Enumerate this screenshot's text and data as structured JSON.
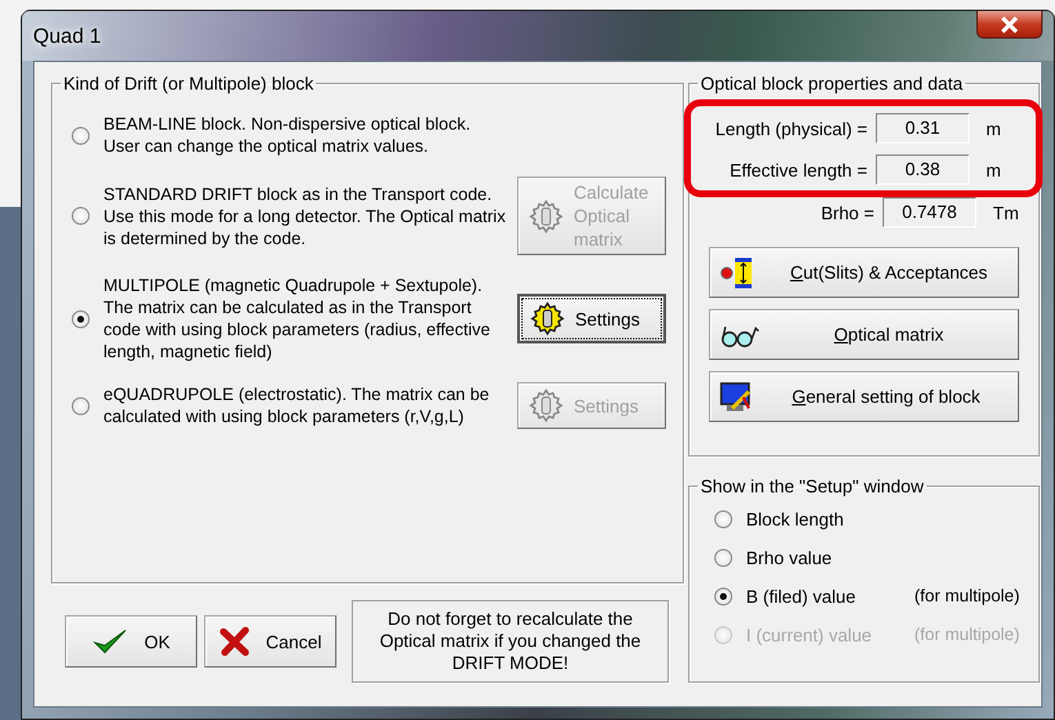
{
  "window": {
    "title": "Quad 1"
  },
  "drift_group": {
    "title": "Kind of Drift (or Multipole) block",
    "options": [
      {
        "text": "BEAM-LINE block. Non-dispersive optical block. User can change the optical matrix values.",
        "selected": false
      },
      {
        "text": " STANDARD DRIFT block as in the Transport code. Use this mode for a long detector. The Optical matrix is determined by the code.",
        "selected": false,
        "button": {
          "label": "Calculate Optical matrix",
          "disabled": true,
          "focused": false
        }
      },
      {
        "text": "MULTIPOLE (magnetic Quadrupole + Sextupole). The matrix can be calculated as in the Transport code with using block parameters  (radius, effective length, magnetic field)",
        "selected": true,
        "button": {
          "label": "Settings",
          "disabled": false,
          "focused": true
        }
      },
      {
        "text": "eQUADRUPOLE (electrostatic). The matrix can be calculated with using block parameters  (r,V,g,L)",
        "selected": false,
        "button": {
          "label": "Settings",
          "disabled": true,
          "focused": false
        }
      }
    ]
  },
  "properties": {
    "title": "Optical block properties and data",
    "fields": [
      {
        "label": "Length (physical) =",
        "value": "0.31",
        "unit": "m",
        "highlighted": true
      },
      {
        "label": "Effective length =",
        "value": "0.38",
        "unit": "m",
        "highlighted": true
      },
      {
        "label": "Brho =",
        "value": "0.7478",
        "unit": "Tm",
        "highlighted": false
      }
    ],
    "actions": [
      {
        "kind": "slits",
        "key": "C",
        "rest": "ut(Slits) & Acceptances"
      },
      {
        "kind": "matrix",
        "key": "O",
        "rest": "ptical matrix"
      },
      {
        "kind": "general",
        "key": "G",
        "rest": "eneral setting of block"
      }
    ]
  },
  "show_group": {
    "title": "Show in the \"Setup\" window",
    "options": [
      {
        "label": "Block length",
        "selected": false,
        "disabled": false
      },
      {
        "label": "Brho value",
        "selected": false,
        "disabled": false
      },
      {
        "label": "B (filed) value",
        "note": "(for multipole)",
        "selected": true,
        "disabled": false
      },
      {
        "label": "I (current) value",
        "note": "(for multipole)",
        "selected": false,
        "disabled": true
      }
    ]
  },
  "footer": {
    "buttons": [
      {
        "label": "OK",
        "kind": "ok"
      },
      {
        "label": "Cancel",
        "kind": "cancel"
      }
    ],
    "note": "Do not forget to recalculate the Optical matrix if you changed the DRIFT MODE!"
  }
}
